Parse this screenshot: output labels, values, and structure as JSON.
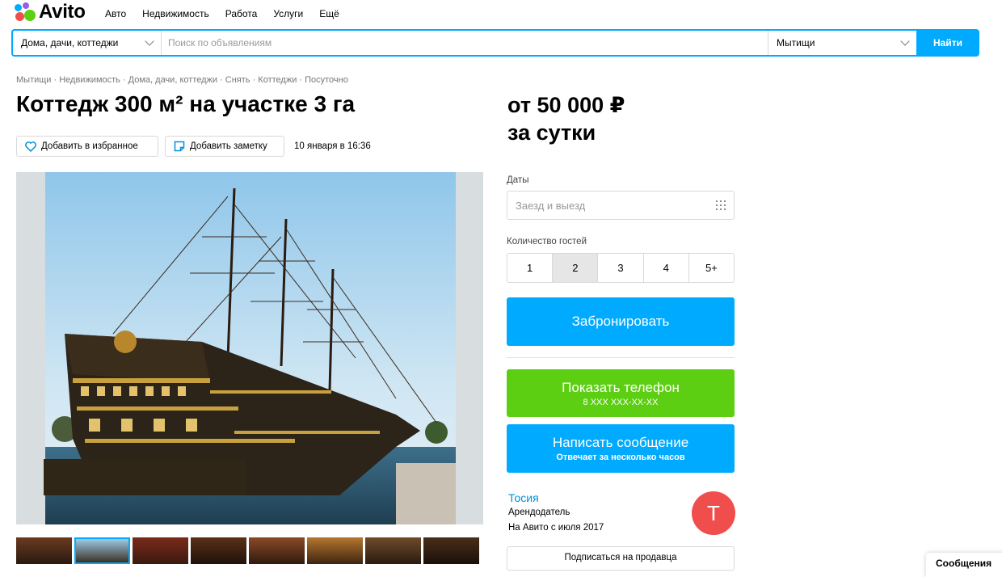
{
  "header": {
    "logo_text": "Avito",
    "nav": [
      "Авто",
      "Недвижимость",
      "Работа",
      "Услуги",
      "Ещё"
    ]
  },
  "search": {
    "category": "Дома, дачи, коттеджи",
    "placeholder": "Поиск по объявлениям",
    "city": "Мытищи",
    "find_label": "Найти",
    "accent": "#00aaff"
  },
  "breadcrumbs": "Мытищи · Недвижимость · Дома, дачи, коттеджи · Снять · Коттеджи · Посуточно",
  "listing": {
    "title": "Коттедж 300 м² на участке 3 га",
    "favorite_label": "Добавить в избранное",
    "note_label": "Добавить заметку",
    "date": "10 января в 16:36"
  },
  "booking": {
    "price_line1": "от 50 000 ₽",
    "price_line2": "за сутки",
    "dates_label": "Даты",
    "dates_placeholder": "Заезд и выезд",
    "guests_label": "Количество гостей",
    "guest_options": [
      "1",
      "2",
      "3",
      "4",
      "5+"
    ],
    "guest_selected": "2",
    "book_label": "Забронировать",
    "phone_label": "Показать телефон",
    "phone_mask": "8 XXX XXX-XX-XX",
    "message_label": "Написать сообщение",
    "message_sub": "Отвечает за несколько часов",
    "book_color": "#00aaff",
    "phone_color": "#5ccf12"
  },
  "seller": {
    "name": "Тосия",
    "role": "Арендодатель",
    "since": "На Авито с июля 2017",
    "avatar_letter": "Т",
    "subscribe_label": "Подписаться на продавца",
    "avatar_color": "#f04e4c"
  },
  "messenger": {
    "label": "Сообщения"
  }
}
